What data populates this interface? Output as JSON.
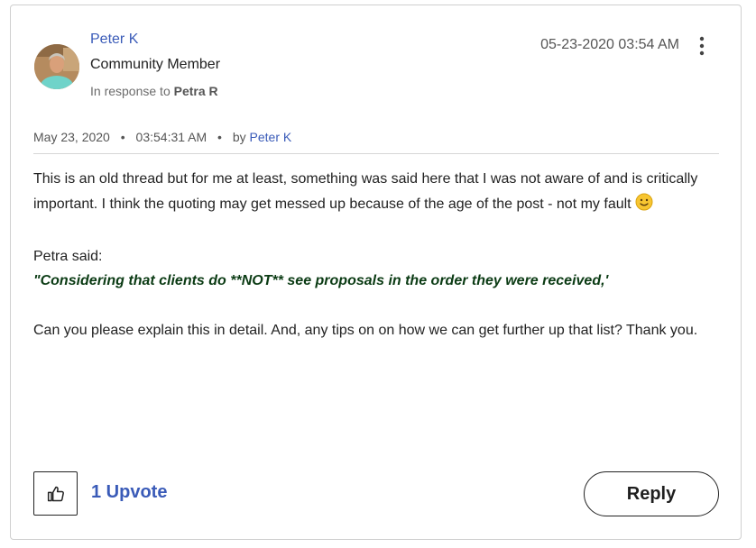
{
  "post": {
    "author": {
      "name": "Peter K",
      "rank": "Community Member"
    },
    "in_response": {
      "prefix": "In response to",
      "target": "Petra R"
    },
    "post_datetime": "05-23-2020 03:54 AM",
    "meta": {
      "date": "May 23, 2020",
      "separator": "•",
      "time": "03:54:31 AM",
      "by_label": "by",
      "by_user": "Peter K"
    },
    "body": {
      "paragraph_1": "This is an old thread but for me at least, something was said here that I was not aware of and is critically important. I think the quoting may get messed up because of the age of the post - not my fault",
      "quote_intro": "Petra said:",
      "quote_text": "\"Considering that clients do **NOT** see proposals in the order they were received,'",
      "paragraph_3": "Can you please explain this in detail. And, any tips on on how we can get further up that list? Thank you."
    },
    "footer": {
      "upvote_label": "1 Upvote",
      "reply_label": "Reply"
    }
  },
  "icons": {
    "menu": "kebab-menu-icon",
    "upvote": "thumbs-up-icon",
    "emoji": "slightly-smiling-face-emoji"
  },
  "colors": {
    "link": "#3a5bb8",
    "quote": "#0b3b14",
    "border": "#cfcfcf"
  }
}
